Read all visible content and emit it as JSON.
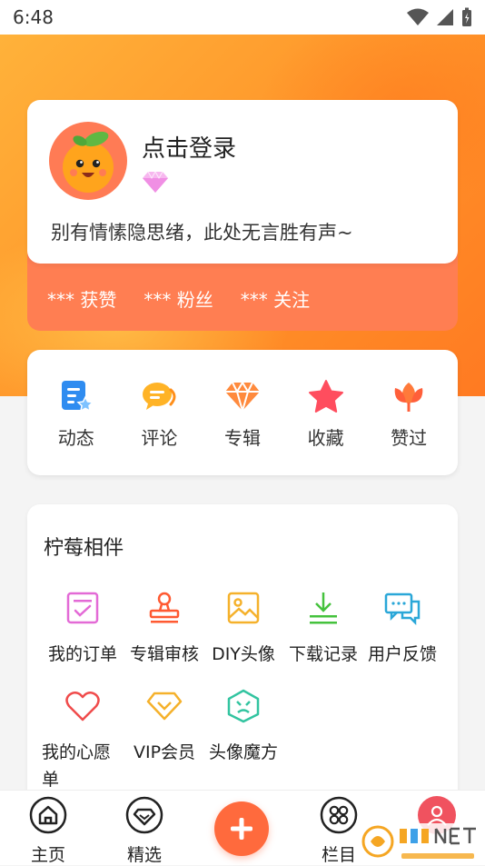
{
  "status_bar": {
    "time": "6:48"
  },
  "profile": {
    "login_text": "点击登录",
    "signature": "别有情愫隐思绪，此处无言胜有声~",
    "stats": [
      {
        "label": "*** 获赞"
      },
      {
        "label": "*** 粉丝"
      },
      {
        "label": "*** 关注"
      }
    ]
  },
  "shortcuts": [
    {
      "label": "动态",
      "icon": "dynamic-icon"
    },
    {
      "label": "评论",
      "icon": "comment-icon"
    },
    {
      "label": "专辑",
      "icon": "album-diamond-icon"
    },
    {
      "label": "收藏",
      "icon": "star-icon"
    },
    {
      "label": "赞过",
      "icon": "flower-icon"
    }
  ],
  "services": {
    "title": "柠莓相伴",
    "items": [
      {
        "label": "我的订单",
        "icon": "order-icon"
      },
      {
        "label": "专辑审核",
        "icon": "stamp-icon"
      },
      {
        "label": "DIY头像",
        "icon": "image-icon"
      },
      {
        "label": "下载记录",
        "icon": "download-icon"
      },
      {
        "label": "用户反馈",
        "icon": "feedback-icon"
      },
      {
        "label": "我的心愿单",
        "icon": "heart-icon"
      },
      {
        "label": "VIP会员",
        "icon": "vip-diamond-icon"
      },
      {
        "label": "头像魔方",
        "icon": "cube-icon"
      }
    ]
  },
  "bottom_nav": [
    {
      "label": "主页",
      "icon": "home-icon"
    },
    {
      "label": "精选",
      "icon": "featured-diamond-icon"
    },
    {
      "label": "",
      "icon": "plus-icon"
    },
    {
      "label": "栏目",
      "icon": "grid-icon"
    },
    {
      "label": "",
      "icon": "profile-icon"
    }
  ],
  "colors": {
    "accent": "#ff6a3d",
    "header_start": "#ffb23a",
    "header_end": "#ff7a22",
    "stats_bar": "#ff7e52"
  }
}
